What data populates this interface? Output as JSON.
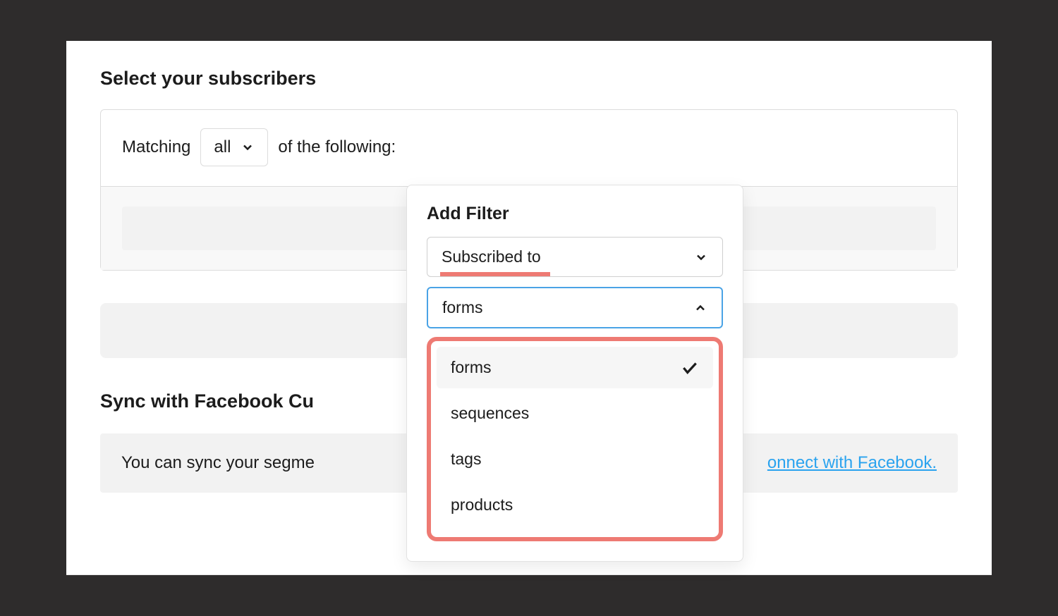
{
  "section_title": "Select your subscribers",
  "filter": {
    "matching_label": "Matching",
    "match_mode": "all",
    "of_following": "of the following:"
  },
  "popover": {
    "title": "Add Filter",
    "filter_type": "Subscribed to",
    "selected_target": "forms",
    "options": [
      "forms",
      "sequences",
      "tags",
      "products"
    ]
  },
  "sync": {
    "title": "Sync with Facebook Cu",
    "banner_text_left": "You can sync your segme",
    "banner_link": "onnect with Facebook."
  }
}
